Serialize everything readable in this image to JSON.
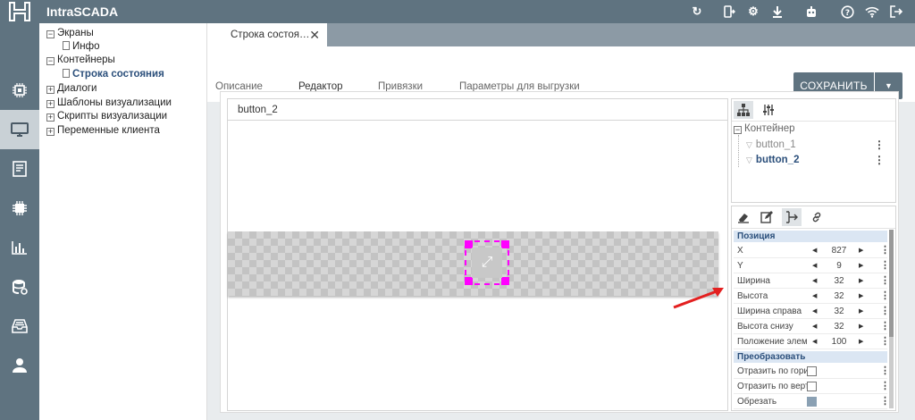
{
  "app": {
    "title": "IntraSCADA"
  },
  "toolbar": {
    "icons": [
      "refresh-icon",
      "mobile-export-icon",
      "gear-icon",
      "download-icon",
      "robot-icon",
      "help-icon",
      "wifi-icon",
      "logout-icon"
    ]
  },
  "leftnav": {
    "items": [
      "chip-icon",
      "monitor-icon",
      "document-icon",
      "processor-icon",
      "bar-chart-icon",
      "database-gear-icon",
      "inbox-tray-icon",
      "user-icon"
    ],
    "active_index": 1
  },
  "tree": {
    "items": [
      {
        "label": "Экраны",
        "toggle": "−"
      },
      {
        "label": "Инфо"
      },
      {
        "label": "Контейнеры",
        "toggle": "−"
      },
      {
        "label": "Строка состояния"
      },
      {
        "label": "Диалоги",
        "toggle": "+"
      },
      {
        "label": "Шаблоны визуализации",
        "toggle": "+"
      },
      {
        "label": "Скрипты визуализации",
        "toggle": "+"
      },
      {
        "label": "Переменные клиента",
        "toggle": "+"
      }
    ]
  },
  "doc_tab": {
    "label": "Строка состоя…",
    "close": "✕"
  },
  "subtabs": {
    "items": [
      "Описание",
      "Редактор",
      "Привязки",
      "Параметры для выгрузки"
    ],
    "active": "Редактор"
  },
  "actions": {
    "save_label": "СОХРАНИТЬ",
    "dropdown_glyph": "▼"
  },
  "editor": {
    "title": "button_2",
    "selection_glyph": "⤢"
  },
  "layers": {
    "toggle": "−",
    "root": "Контейнер",
    "children": [
      {
        "label": "button_1",
        "selected": false
      },
      {
        "label": "button_2",
        "selected": true
      }
    ],
    "kebab": "⋮"
  },
  "properties": {
    "sections": [
      {
        "title": "Позиция",
        "rows": [
          {
            "label": "X",
            "value": "827"
          },
          {
            "label": "Y",
            "value": "9"
          },
          {
            "label": "Ширина",
            "value": "32"
          },
          {
            "label": "Высота",
            "value": "32"
          },
          {
            "label": "Ширина справа",
            "value": "32"
          },
          {
            "label": "Высота снизу",
            "value": "32"
          },
          {
            "label": "Положение элемента",
            "value": "100"
          }
        ]
      },
      {
        "title": "Преобразовать",
        "rows": [
          {
            "label": "Отразить по горизонтали",
            "checkbox": false
          },
          {
            "label": "Отразить по вертикали",
            "checkbox": false
          },
          {
            "label": "Обрезать",
            "checkbox": true
          }
        ]
      }
    ],
    "arrow_left": "◀",
    "arrow_right": "▶",
    "kebab": "⋮"
  },
  "colors": {
    "chrome": "#5f7380",
    "accent": "#2b4f7b",
    "selection": "#ff00ff",
    "pointer_arrow": "#e32020"
  }
}
